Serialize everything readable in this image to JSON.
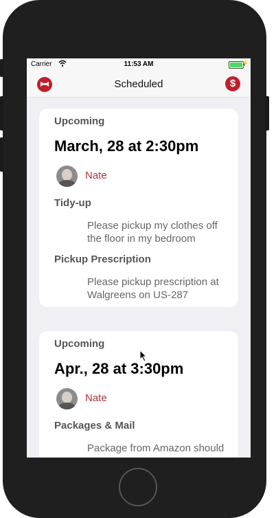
{
  "status_bar": {
    "carrier": "Carrier",
    "time": "11:53 AM"
  },
  "nav": {
    "title": "Scheduled",
    "left_icon": "bowtie-icon",
    "right_icon": "dollar-icon"
  },
  "cards": [
    {
      "status": "Upcoming",
      "date": "March, 28 at 2:30pm",
      "person": "Nate",
      "tasks": [
        {
          "title": "Tidy-up",
          "desc_line1": "Please pickup my clothes off",
          "desc_line2": "the floor in my bedroom"
        },
        {
          "title": "Pickup Prescription",
          "desc_line1": "Please pickup prescription at",
          "desc_line2": "Walgreens on US-287"
        }
      ]
    },
    {
      "status": "Upcoming",
      "date": "Apr., 28 at 3:30pm",
      "person": "Nate",
      "tasks": [
        {
          "title": "Packages & Mail",
          "desc_line1": "Package from Amazon should",
          "desc_line2": ""
        }
      ]
    }
  ],
  "colors": {
    "accent": "#c0202e",
    "background": "#efeff4"
  }
}
